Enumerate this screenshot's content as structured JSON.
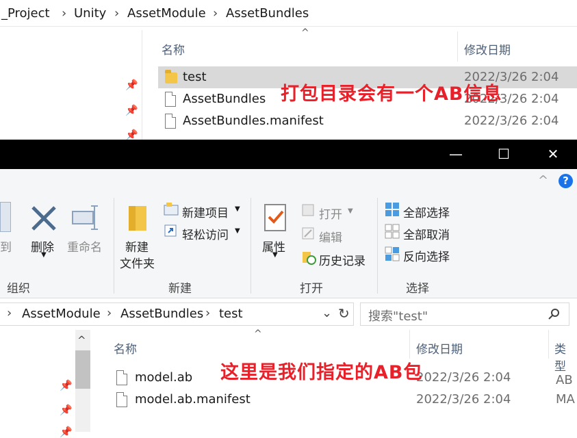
{
  "top_window": {
    "breadcrumb": [
      "_Project",
      "Unity",
      "AssetModule",
      "AssetBundles"
    ],
    "columns": {
      "name": "名称",
      "date": "修改日期"
    },
    "files": [
      {
        "name": "test",
        "date": "2022/3/26 2:04",
        "icon": "folder-icon"
      },
      {
        "name": "AssetBundles",
        "date": "2022/3/26 2:04",
        "icon": "file-icon"
      },
      {
        "name": "AssetBundles.manifest",
        "date": "2022/3/26 2:04",
        "icon": "file-icon"
      }
    ],
    "annotation": "打包目录会有一个AB信息"
  },
  "front_window": {
    "titlebar": {
      "minimize": "—",
      "maximize": "☐",
      "close": "✕"
    },
    "ribbon": {
      "organize": {
        "cut_label": "到",
        "delete_label": "删除",
        "rename_label": "重命名",
        "group_label": "组织"
      },
      "new": {
        "new_folder_line1": "新建",
        "new_folder_line2": "文件夹",
        "new_item": "新建项目",
        "easy_access": "轻松访问",
        "group_label": "新建"
      },
      "open": {
        "properties": "属性",
        "open": "打开",
        "edit": "编辑",
        "history": "历史记录",
        "group_label": "打开"
      },
      "select": {
        "select_all": "全部选择",
        "select_none": "全部取消",
        "invert": "反向选择",
        "group_label": "选择"
      }
    },
    "address": {
      "breadcrumb": [
        "AssetModule",
        "AssetBundles",
        "test"
      ],
      "search_placeholder": "搜索\"test\""
    },
    "columns": {
      "name": "名称",
      "date": "修改日期",
      "type": "类型"
    },
    "files": [
      {
        "name": "model.ab",
        "date": "2022/3/26 2:04",
        "type": "AB 文"
      },
      {
        "name": "model.ab.manifest",
        "date": "2022/3/26 2:04",
        "type": "MA"
      }
    ],
    "annotation": "这里是我们指定的AB包"
  },
  "colors": {
    "annotation": "#e8202a",
    "selected_row": "#d9d9d9",
    "help": "#1a73e8"
  }
}
